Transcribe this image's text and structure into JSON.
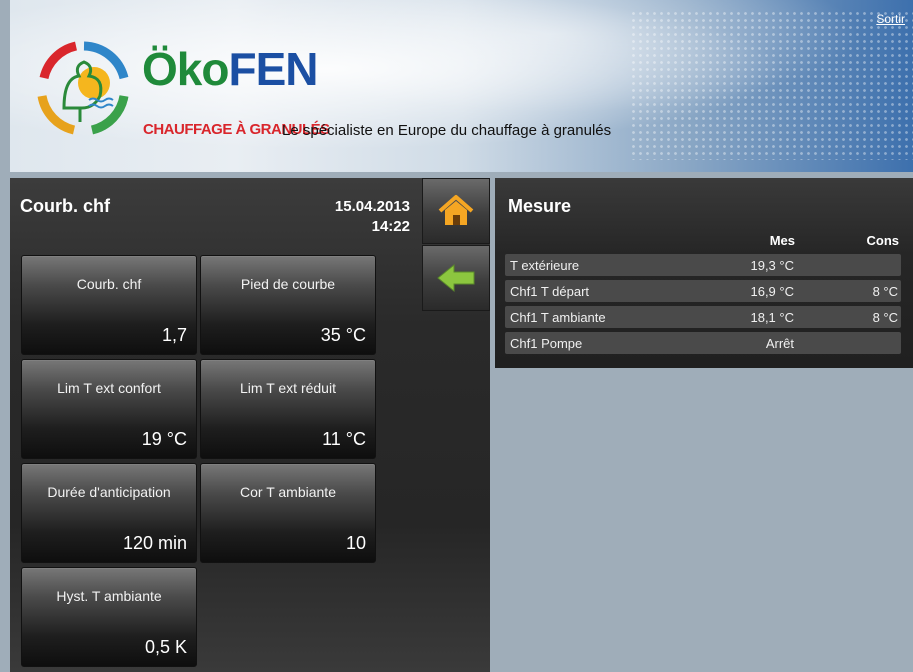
{
  "header": {
    "brand_part1": "Öko",
    "brand_part2": "FEN",
    "brand_sub": "CHAUFFAGE À GRANULÉS",
    "tagline": "Le spécialiste en Europe du chauffage à granulés",
    "logout_label": "Sortir"
  },
  "left_panel": {
    "title": "Courb. chf",
    "date": "15.04.2013",
    "time": "14:22",
    "nav": {
      "home_icon": "home-icon",
      "back_icon": "arrow-left-icon"
    },
    "tiles": [
      {
        "label": "Courb. chf",
        "value": "1,7"
      },
      {
        "label": "Pied de courbe",
        "value": "35 °C"
      },
      {
        "label": "Lim T ext confort",
        "value": "19 °C"
      },
      {
        "label": "Lim T ext réduit",
        "value": "11 °C"
      },
      {
        "label": "Durée d'anticipation",
        "value": "120 min"
      },
      {
        "label": "Cor T ambiante",
        "value": "10"
      },
      {
        "label": "Hyst. T ambiante",
        "value": "0,5 K"
      }
    ]
  },
  "measure": {
    "title": "Mesure",
    "col_mes": "Mes",
    "col_cons": "Cons",
    "rows": [
      {
        "name": "T extérieure",
        "mes": "19,3 °C",
        "cons": ""
      },
      {
        "name": "Chf1 T départ",
        "mes": "16,9 °C",
        "cons": "8 °C"
      },
      {
        "name": "Chf1 T ambiante",
        "mes": "18,1 °C",
        "cons": "8 °C"
      },
      {
        "name": "Chf1 Pompe",
        "mes": "Arrêt",
        "cons": ""
      }
    ]
  },
  "colors": {
    "brand_green": "#1f8a3a",
    "brand_blue": "#1b4fa3",
    "brand_red": "#d9262c",
    "home_icon": "#f5a623",
    "back_icon": "#8cc63f"
  }
}
